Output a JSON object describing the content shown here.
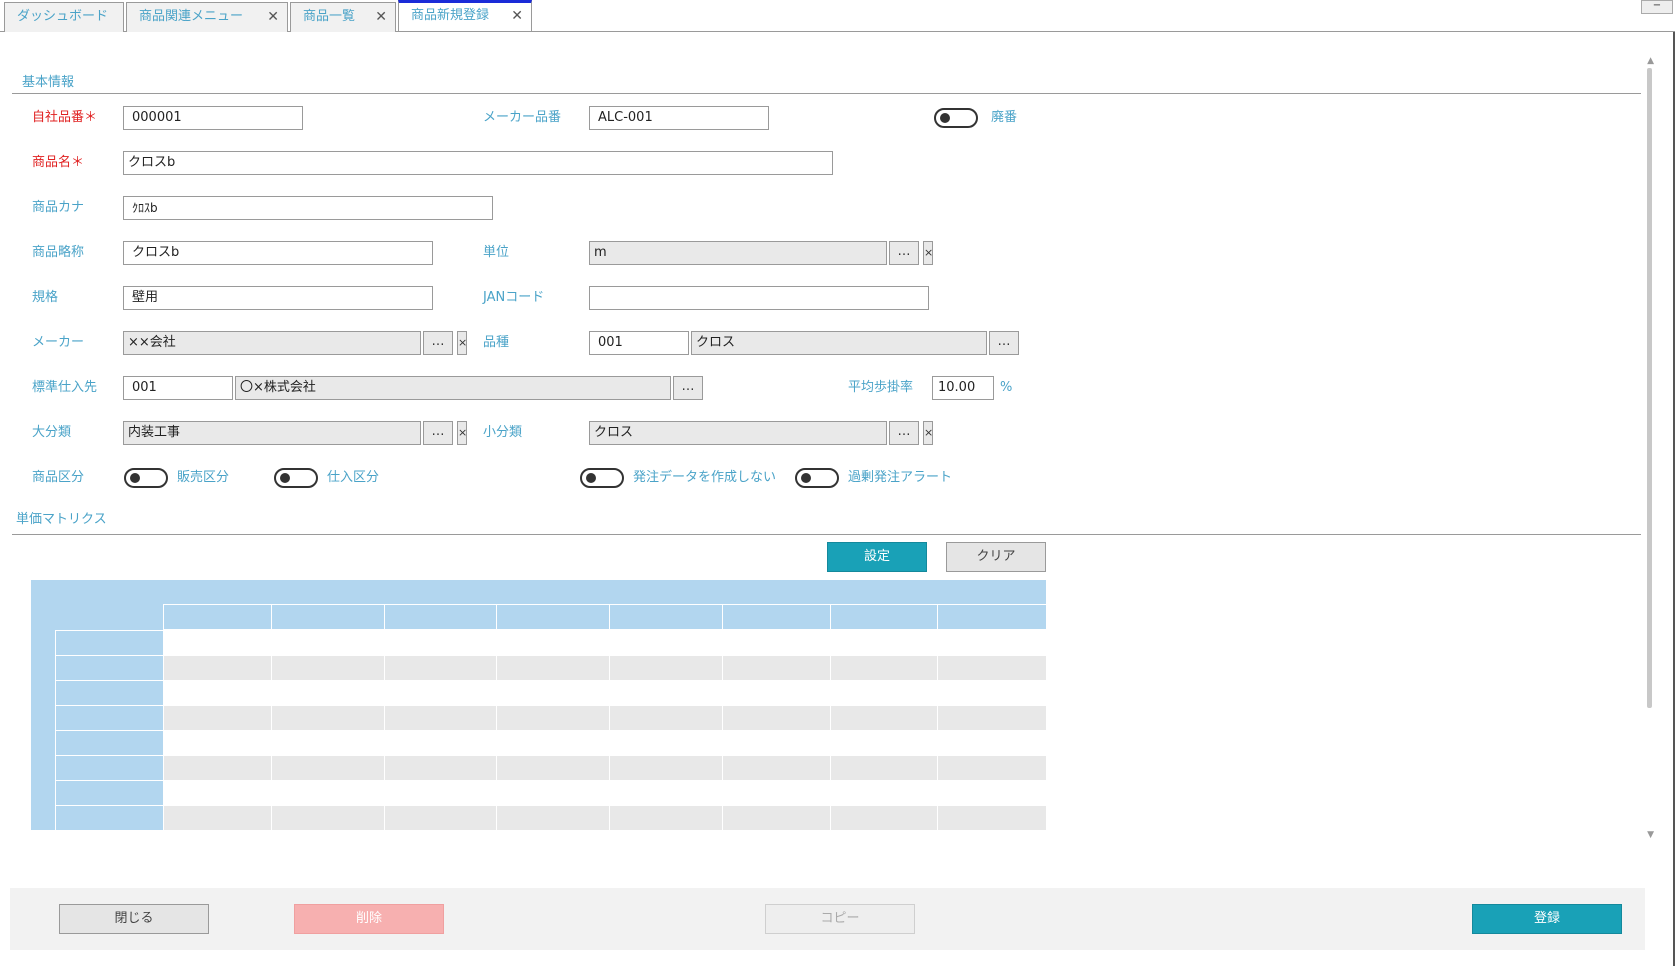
{
  "tabs": [
    {
      "label": "ダッシュボード",
      "closable": false
    },
    {
      "label": "商品関連メニュー",
      "closable": true
    },
    {
      "label": "商品一覧",
      "closable": true
    },
    {
      "label": "商品新規登録",
      "closable": true,
      "active": true
    }
  ],
  "window": {
    "minimize": "−"
  },
  "sections": {
    "basic": "基本情報",
    "matrix": "単価マトリクス"
  },
  "form": {
    "product_code": {
      "label": "自社品番＊",
      "value": "000001"
    },
    "maker_code": {
      "label": "メーカー品番",
      "value": "ALC-001"
    },
    "discontinued": {
      "label": "廃番",
      "on": false
    },
    "product_name": {
      "label": "商品名＊",
      "value": "クロスb"
    },
    "product_kana": {
      "label": "商品カナ",
      "value": "ｸﾛｽb"
    },
    "product_short": {
      "label": "商品略称",
      "value": "クロスb"
    },
    "unit": {
      "label": "単位",
      "value": "m"
    },
    "spec": {
      "label": "規格",
      "value": "壁用"
    },
    "jan": {
      "label": "JANコード",
      "value": ""
    },
    "maker": {
      "label": "メーカー",
      "value": "××会社"
    },
    "category": {
      "label": "品種",
      "code": "001",
      "value": "クロス"
    },
    "supplier": {
      "label": "標準仕入先",
      "code": "001",
      "value": "〇×株式会社"
    },
    "avg_rate": {
      "label": "平均歩掛率",
      "value": "10.00",
      "unit": "%"
    },
    "major_class": {
      "label": "大分類",
      "value": "内装工事"
    },
    "minor_class": {
      "label": "小分類",
      "value": "クロス"
    },
    "product_type": {
      "label": "商品区分"
    },
    "sales_type": {
      "label": "販売区分",
      "on": false
    },
    "purchase_type": {
      "label": "仕入区分",
      "on": false
    },
    "no_order_data": {
      "label": "発注データを作成しない",
      "on": false
    },
    "over_order_alert": {
      "label": "過剰発注アラート",
      "on": false
    }
  },
  "icons": {
    "dots": "…",
    "clear": "×",
    "close": "✕"
  },
  "matrix_buttons": {
    "set": "設定",
    "clear": "クリア"
  },
  "footer": {
    "close": "閉じる",
    "delete": "削除",
    "copy": "コピー",
    "register": "登録"
  },
  "colors": {
    "accent": "#19a1b7",
    "label": "#4aa3c8",
    "required": "#e02020",
    "matrix_header": "#b2d6ef"
  }
}
